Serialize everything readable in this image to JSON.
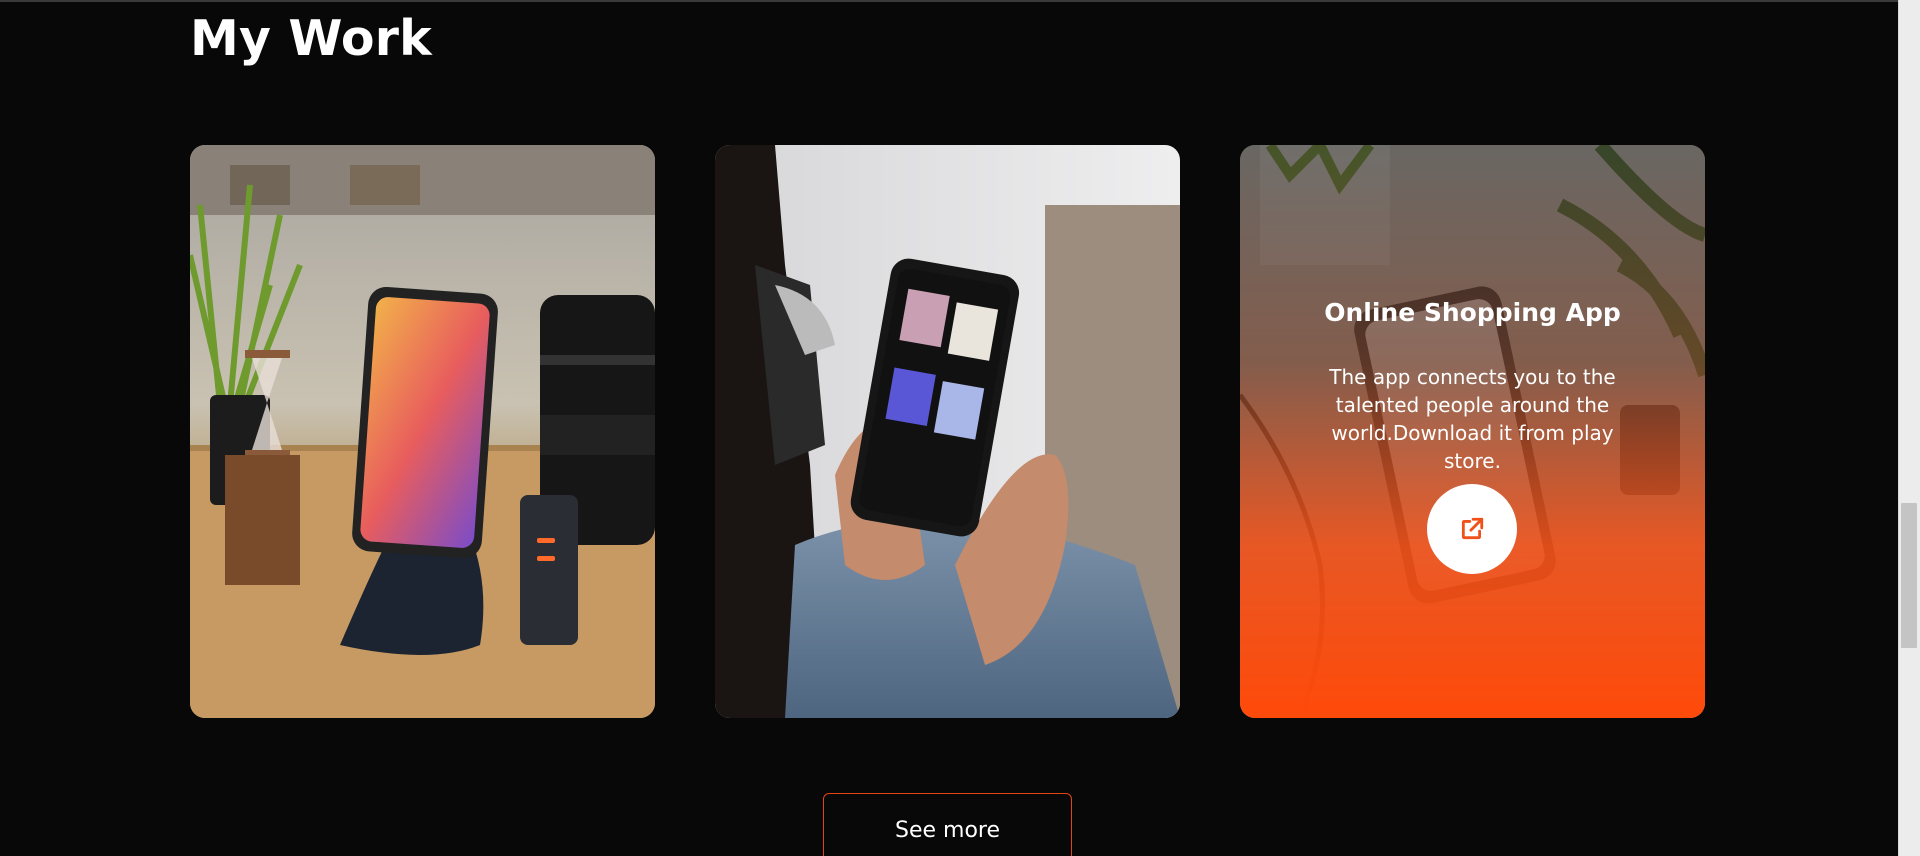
{
  "section": {
    "title": "My Work"
  },
  "cards": [
    {
      "image": "phone-on-stand-photo"
    },
    {
      "image": "hands-holding-phone-photo"
    },
    {
      "image": "shopping-phone-photo",
      "title": "Online Shopping App",
      "description": "The app connects you to the talented people around the world.Download it from play store.",
      "link_icon": "external-link-icon"
    }
  ],
  "see_more_label": "See more",
  "colors": {
    "accent": "#ff4a0a",
    "background": "#080808"
  }
}
